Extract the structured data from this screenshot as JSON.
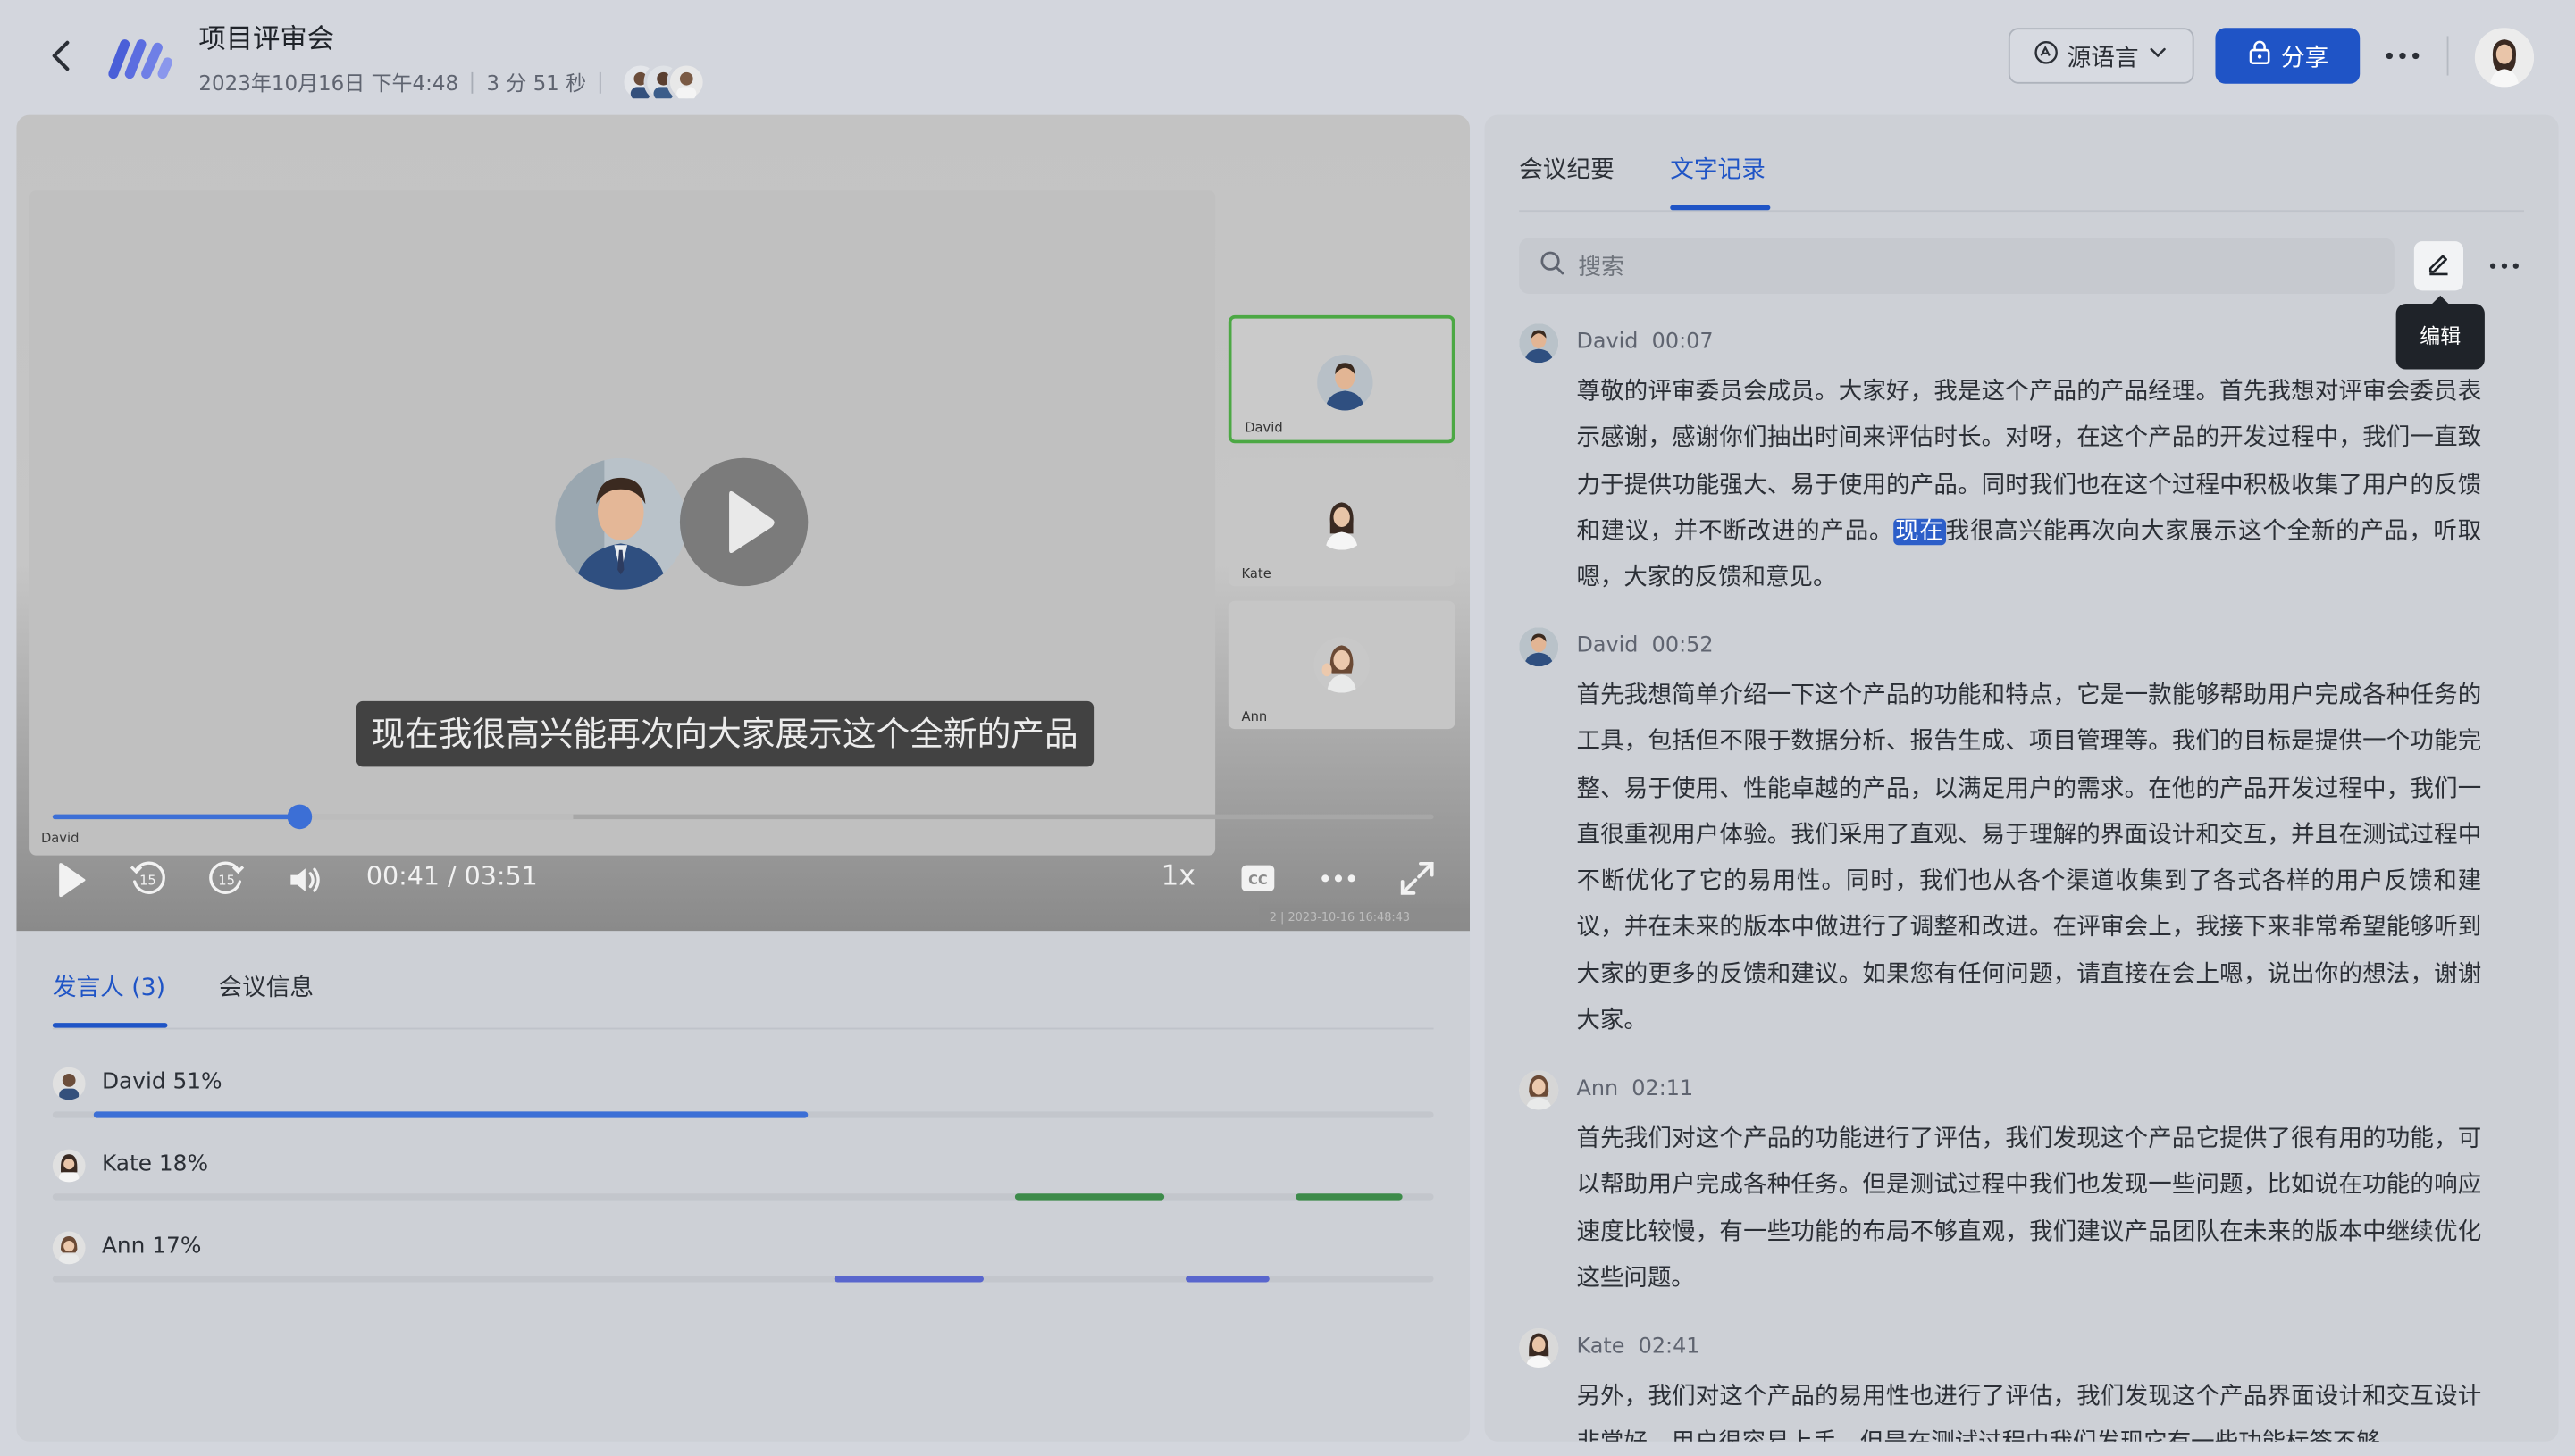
{
  "header": {
    "title": "项目评审会",
    "date": "2023年10月16日 下午4:48",
    "duration": "3 分 51 秒",
    "language_button": "源语言",
    "share_button": "分享"
  },
  "video": {
    "subtitle": "现在我很高兴能再次向大家展示这个全新的产品",
    "current_speaker": "David",
    "time": "00:41 / 03:51",
    "progress_fraction": 0.178,
    "speed": "1x",
    "cc": "CC",
    "skip_seconds": "15",
    "watermark": "2 | 2023-10-16 16:48:43",
    "participants": [
      {
        "name": "David",
        "active": true
      },
      {
        "name": "Kate",
        "active": false
      },
      {
        "name": "Ann",
        "active": false
      }
    ]
  },
  "stats": {
    "tabs": {
      "speakers": "发言人 (3)",
      "info": "会议信息"
    },
    "speakers": [
      {
        "label": "David 51%",
        "color": "#3c6fd6",
        "segments": [
          [
            0.03,
            0.547
          ]
        ]
      },
      {
        "label": "Kate 18%",
        "color": "#3d8b4a",
        "segments": [
          [
            0.697,
            0.805
          ],
          [
            0.9,
            0.977
          ]
        ]
      },
      {
        "label": "Ann 17%",
        "color": "#5966cd",
        "segments": [
          [
            0.566,
            0.674
          ],
          [
            0.821,
            0.881
          ]
        ]
      }
    ]
  },
  "transcript": {
    "tabs": {
      "summary": "会议纪要",
      "transcript": "文字记录"
    },
    "search_placeholder": "搜索",
    "edit_tooltip": "编辑",
    "entries": [
      {
        "speaker": "David",
        "time": "00:07",
        "before": "尊敬的评审委员会成员。大家好，我是这个产品的产品经理。首先我想对评审会委员表示感谢，感谢你们抽出时间来评估时长。对呀，在这个产品的开发过程中，我们一直致力于提供功能强大、易于使用的产品。同时我们也在这个过程中积极收集了用户的反馈和建议，并不断改进的产品。",
        "highlight": "现在",
        "after": "我很高兴能再次向大家展示这个全新的产品，听取嗯，大家的反馈和意见。"
      },
      {
        "speaker": "David",
        "time": "00:52",
        "before": "首先我想简单介绍一下这个产品的功能和特点，它是一款能够帮助用户完成各种任务的工具，包括但不限于数据分析、报告生成、项目管理等。我们的目标是提供一个功能完整、易于使用、性能卓越的产品，以满足用户的需求。在他的产品开发过程中，我们一直很重视用户体验。我们采用了直观、易于理解的界面设计和交互，并且在测试过程中不断优化了它的易用性。同时，我们也从各个渠道收集到了各式各样的用户反馈和建议，并在未来的版本中做进行了调整和改进。在评审会上，我接下来非常希望能够听到大家的更多的反馈和建议。如果您有任何问题，请直接在会上嗯，说出你的想法，谢谢大家。",
        "highlight": "",
        "after": ""
      },
      {
        "speaker": "Ann",
        "time": "02:11",
        "before": "首先我们对这个产品的功能进行了评估，我们发现这个产品它提供了很有用的功能，可以帮助用户完成各种任务。但是测试过程中我们也发现一些问题，比如说在功能的响应速度比较慢，有一些功能的布局不够直观，我们建议产品团队在未来的版本中继续优化这些问题。",
        "highlight": "",
        "after": ""
      },
      {
        "speaker": "Kate",
        "time": "02:41",
        "before": "另外，我们对这个产品的易用性也进行了评估，我们发现这个产品界面设计和交互设计非常好，用户很容易上手。但是在测试过程中我们发现它有一些功能标签不够",
        "highlight": "",
        "after": ""
      }
    ]
  },
  "icons": {
    "back": "chevron-left-icon",
    "logo": "app-logo-icon",
    "language": "translate-icon",
    "share": "lock-share-icon",
    "more": "ellipsis-icon",
    "play": "play-icon",
    "rewind": "rewind-15-icon",
    "forward": "forward-15-icon",
    "volume": "volume-icon",
    "cc": "closed-caption-icon",
    "fullscreen": "fullscreen-icon",
    "search": "search-icon",
    "edit": "pencil-icon"
  }
}
